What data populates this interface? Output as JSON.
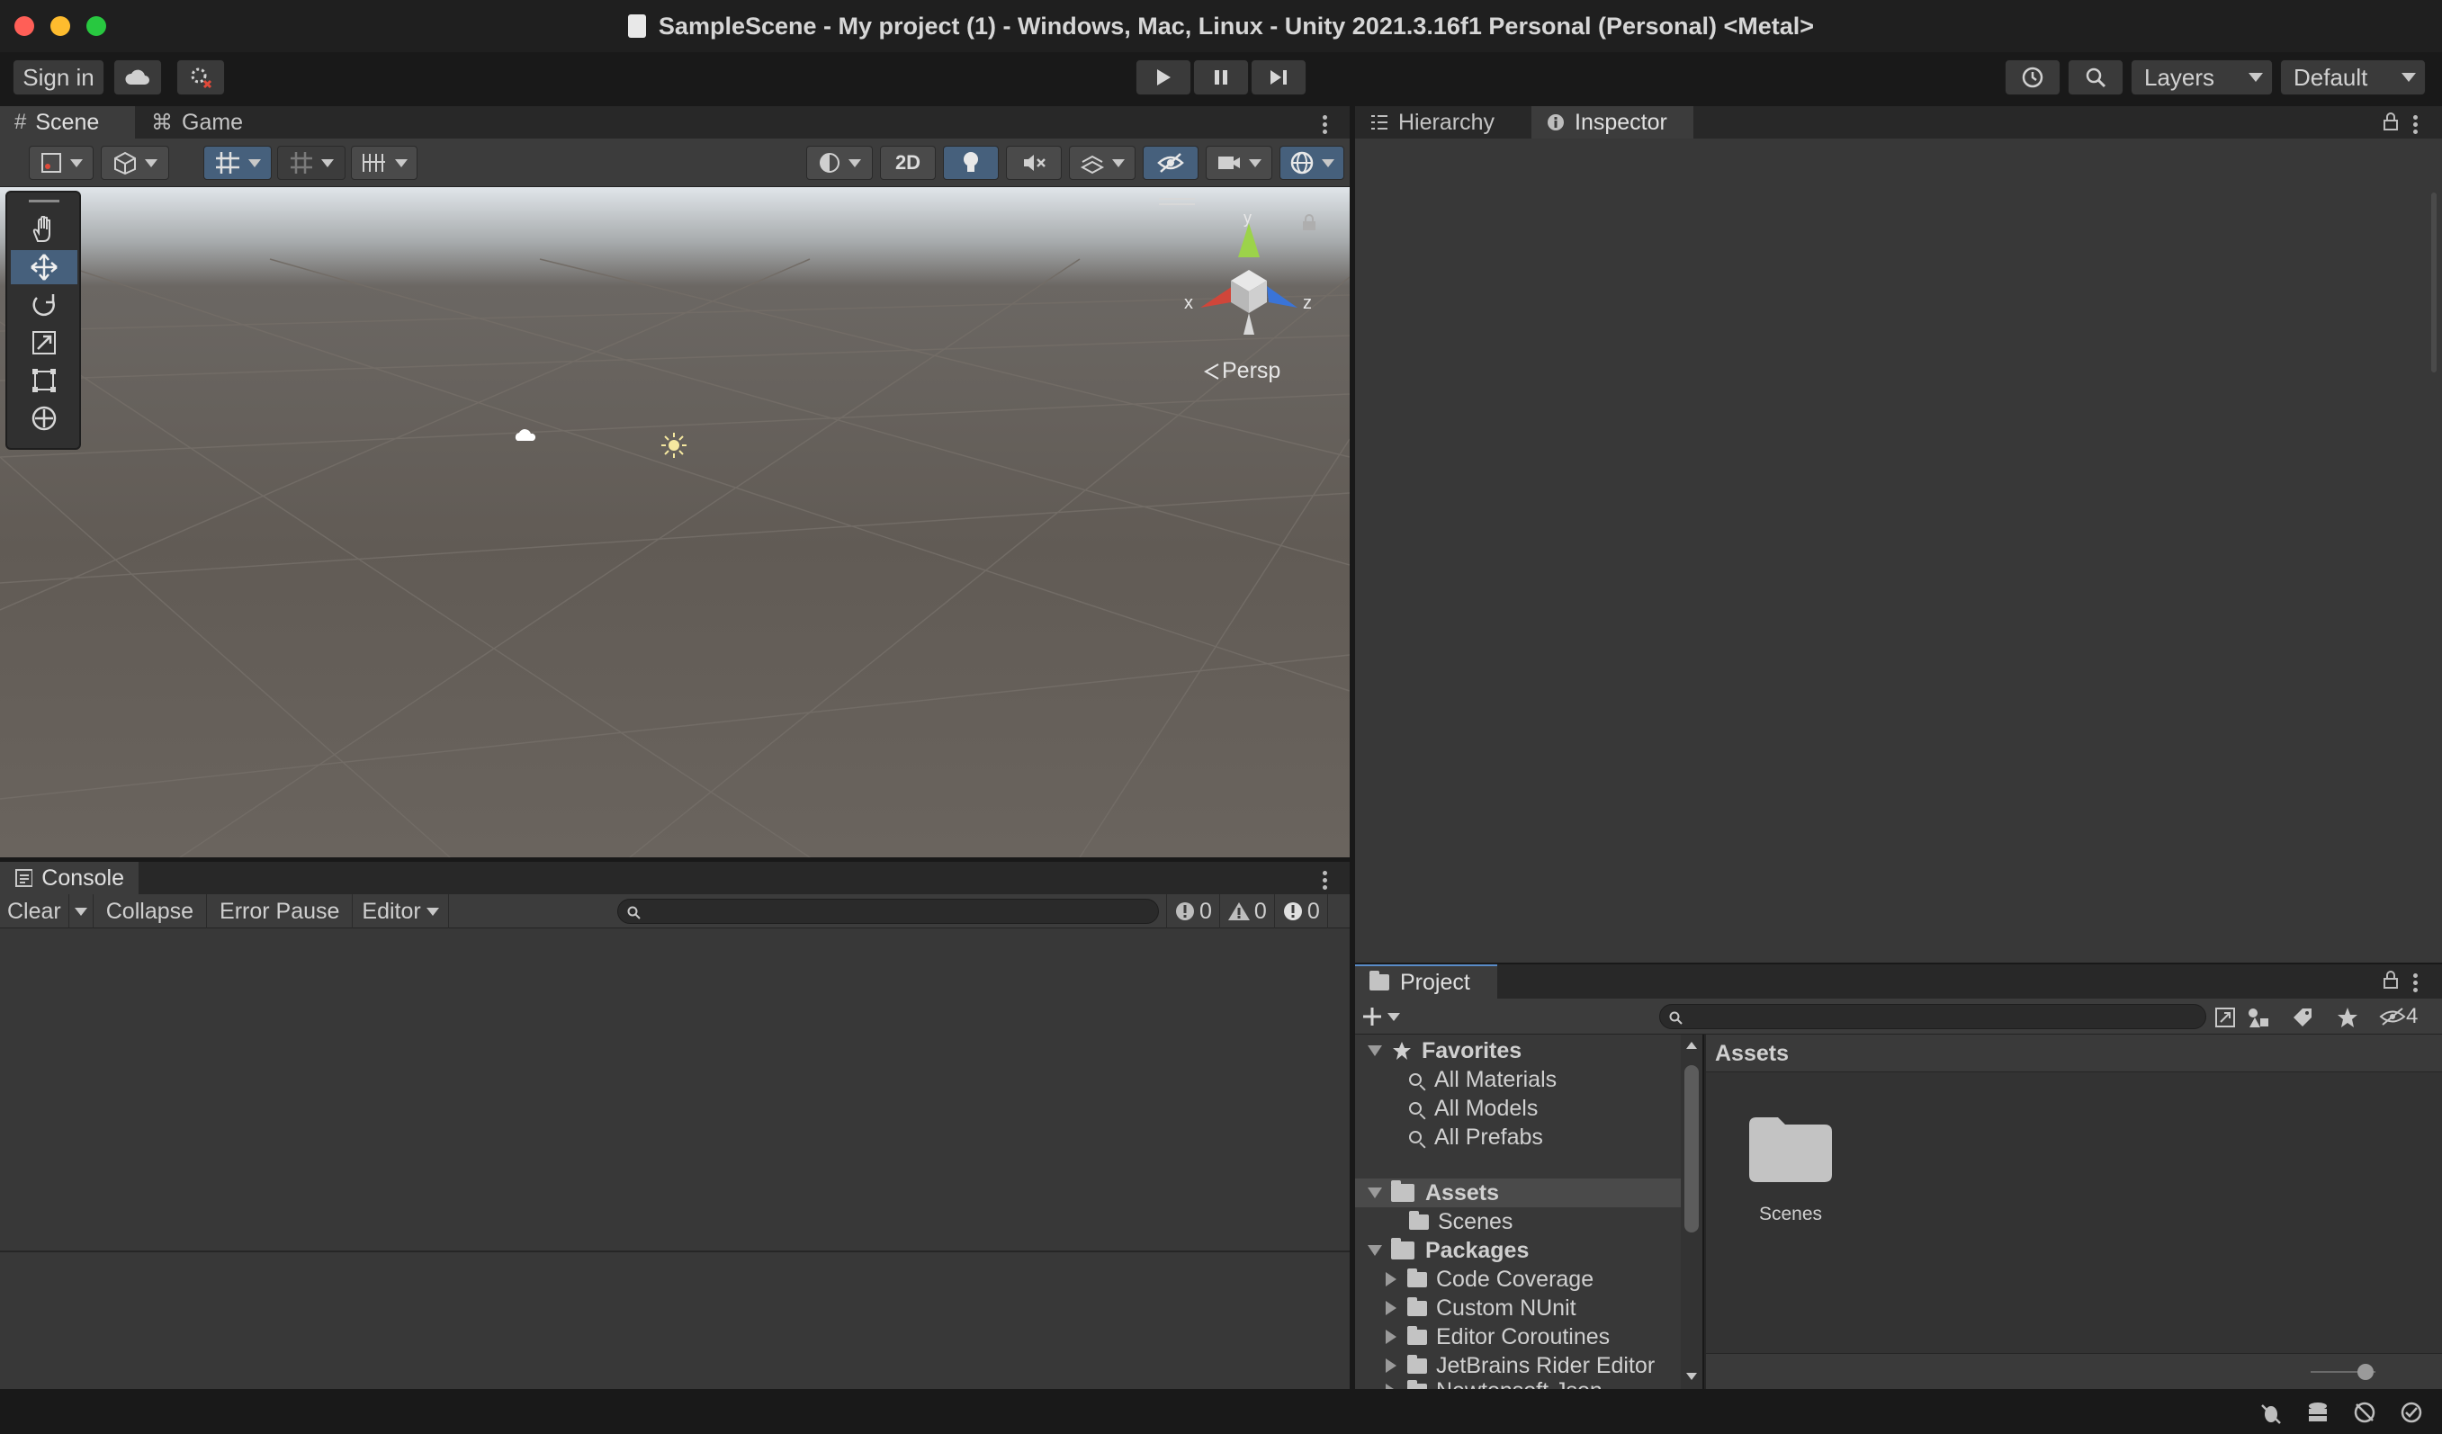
{
  "window": {
    "title": "SampleScene - My project (1) - Windows, Mac, Linux - Unity 2021.3.16f1 Personal (Personal) <Metal>"
  },
  "toolbar": {
    "sign_in": "Sign in",
    "layers": "Layers",
    "layout": "Default"
  },
  "scene_panel": {
    "tabs": [
      "Scene",
      "Game"
    ],
    "toggle_2d": "2D",
    "persp_label": "Persp",
    "axis_x": "x",
    "axis_y": "y",
    "axis_z": "z"
  },
  "console": {
    "tab": "Console",
    "clear": "Clear",
    "collapse": "Collapse",
    "error_pause": "Error Pause",
    "editor": "Editor",
    "log_count": "0",
    "warning_count": "0",
    "error_count": "0"
  },
  "right_panel": {
    "tabs": [
      "Hierarchy",
      "Inspector"
    ]
  },
  "project": {
    "tab": "Project",
    "hidden_count": "4",
    "breadcrumb": "Assets",
    "tree": {
      "favorites": "Favorites",
      "favorites_items": [
        "All Materials",
        "All Models",
        "All Prefabs"
      ],
      "assets": "Assets",
      "assets_items": [
        "Scenes"
      ],
      "packages": "Packages",
      "packages_items": [
        "Code Coverage",
        "Custom NUnit",
        "Editor Coroutines",
        "JetBrains Rider Editor",
        "Newtonsoft Json"
      ]
    },
    "grid_items": [
      "Scenes"
    ]
  },
  "colors": {
    "accent_selected": "#46607c",
    "window_close": "#ff5f57",
    "window_minimize": "#febc2e",
    "window_zoom": "#28c840"
  }
}
